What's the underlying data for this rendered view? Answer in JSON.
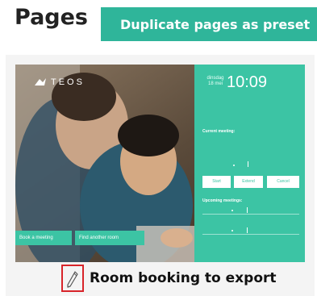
{
  "header": {
    "title": "Pages",
    "duplicate_button_label": "Duplicate pages as preset"
  },
  "card": {
    "title": "Room booking to export",
    "edit_icon": "pencil-icon",
    "preview": {
      "logo_text": "TEOS",
      "date_line1": "dinsdag",
      "date_line2": "18 mei",
      "time": "10:09",
      "current_meeting_label": "Current meeting:",
      "start_label": "Start",
      "extend_label": "Extend",
      "cancel_label": "Cancel",
      "upcoming_label": "Upcoming meetings:",
      "book_label": "Book a meeting",
      "find_label": "Find another room"
    }
  },
  "colors": {
    "accent": "#2fb59a",
    "panel": "#3cc4a4",
    "highlight_border": "#d8242a"
  }
}
